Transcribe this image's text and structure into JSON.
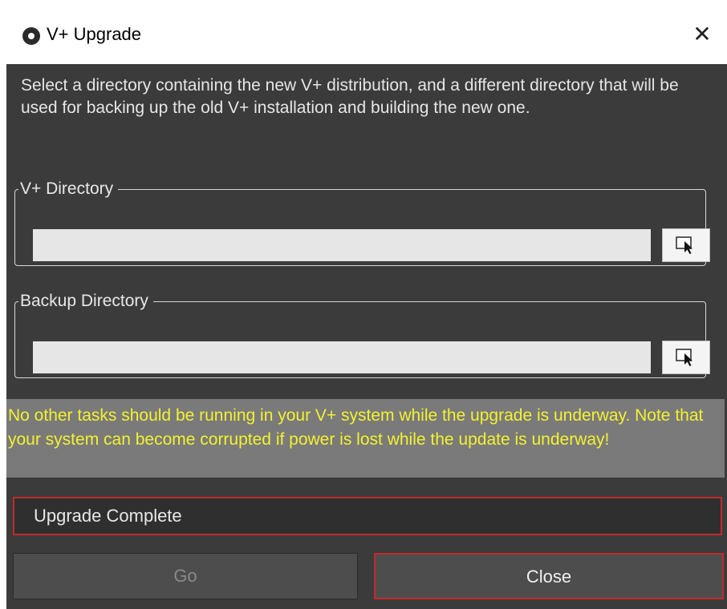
{
  "window": {
    "title": "V+ Upgrade",
    "close_icon": "close-icon"
  },
  "intro_text": "Select a directory containing the new V+ distribution, and a different directory that will be used for backing up the old V+ installation and building the new one.",
  "vplus_directory": {
    "label": "V+ Directory",
    "value": "",
    "browse_icon": "cursor-select-icon"
  },
  "backup_directory": {
    "label": "Backup Directory",
    "value": "",
    "browse_icon": "cursor-select-icon"
  },
  "warning_text": "No other tasks should be running in your V+ system while the upgrade is underway. Note that your system can become corrupted if power is lost while the update is underway!",
  "status_text": "Upgrade Complete",
  "buttons": {
    "go_label": "Go",
    "close_label": "Close"
  },
  "colors": {
    "background": "#3b3b3b",
    "warning_text": "#f2f230",
    "warning_bg": "#7a7a7a",
    "highlight_border": "#c22a2a"
  }
}
